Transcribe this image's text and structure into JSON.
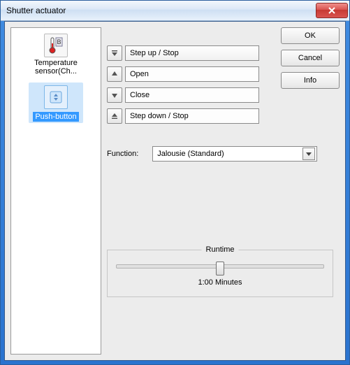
{
  "window": {
    "title": "Shutter actuator"
  },
  "buttons": {
    "ok": "OK",
    "cancel": "Cancel",
    "info": "Info"
  },
  "sidebar": {
    "items": [
      {
        "label": "Temperature sensor(Ch...",
        "icon": "thermometer-icon",
        "selected": false
      },
      {
        "label": "Push-button",
        "icon": "push-button-icon",
        "selected": true
      }
    ]
  },
  "actions": {
    "items": [
      {
        "icon": "step-up-icon",
        "label": "Step up / Stop",
        "active": true
      },
      {
        "icon": "arrow-up-icon",
        "label": "Open",
        "active": false
      },
      {
        "icon": "arrow-down-icon",
        "label": "Close",
        "active": false
      },
      {
        "icon": "step-down-icon",
        "label": "Step down / Stop",
        "active": false
      }
    ]
  },
  "function_row": {
    "label": "Function:",
    "value": "Jalousie (Standard)"
  },
  "runtime": {
    "title": "Runtime",
    "value": "1:00 Minutes"
  }
}
